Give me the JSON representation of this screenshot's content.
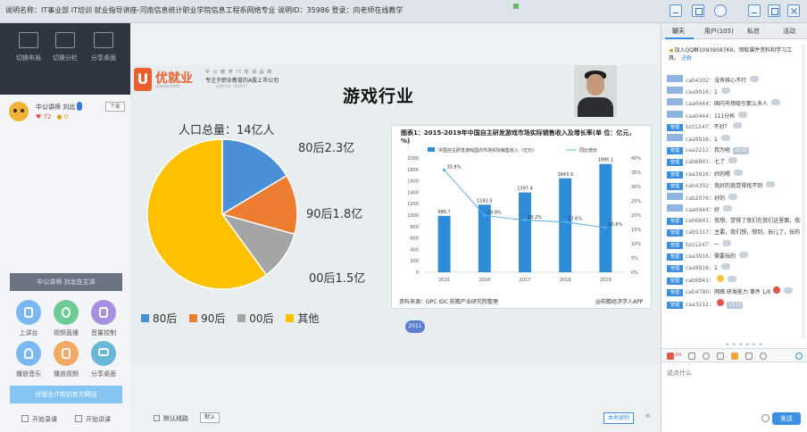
{
  "titlebar": {
    "text": "说明名称：IT事业部 IT培训 就业指导讲座-河南信息统计职业学院信息工程系网络专业 说明ID：35986 登录：向老师在线教学"
  },
  "left": {
    "tools": [
      {
        "label": "切换布局",
        "icon": "layout-icon"
      },
      {
        "label": "切换分栏",
        "icon": "column-icon"
      },
      {
        "label": "分享桌面",
        "icon": "share-desktop-icon"
      }
    ],
    "presenter": {
      "name": "中公讲师 刘北",
      "likes": "72",
      "coins": "0",
      "down_label": "下麦"
    },
    "topic": "中公讲师 刘北在主讲",
    "buttons": [
      {
        "label": "上讲台",
        "color": "#7bb7f0"
      },
      {
        "label": "视频直播",
        "color": "#6ecb93"
      },
      {
        "label": "音量控制",
        "color": "#a890e0"
      },
      {
        "label": "播放音乐",
        "color": "#7bb7f0"
      },
      {
        "label": "播放视频",
        "color": "#f3a866"
      },
      {
        "label": "分享桌面",
        "color": "#6ab8d8"
      }
    ],
    "link": "优就业IT培训官方网站",
    "bottom": [
      {
        "label": "开始录课"
      },
      {
        "label": "开始讲课"
      }
    ]
  },
  "slide": {
    "logo_letter": "U",
    "logo_text": "优就业",
    "logo_sub": "ujiuye.com",
    "tag1": "中 公 教 育 IT 培 训 品 牌",
    "tag2": "专注于职业教育的A股上市公司",
    "tag3": "股票代码：002607",
    "title": "游戏行业",
    "population": "人口总量：14亿人",
    "pie_labels": [
      "80后2.3亿",
      "90后1.8亿",
      "00后1.5亿"
    ],
    "legend": [
      {
        "label": "80后",
        "color": "#4a90d9"
      },
      {
        "label": "90后",
        "color": "#ed7d31"
      },
      {
        "label": "00后",
        "color": "#a5a5a5"
      },
      {
        "label": "其他",
        "color": "#ffc000"
      }
    ],
    "page_num": "2011",
    "chart_title": "图表1：2015-2019年中国自主研发游戏市场实际销售收入及增长率(单 位：亿元，%)",
    "chart_legend_bar": "中国自主研发游戏国内市场实际销售收入（亿元）",
    "chart_legend_line": "同比增长",
    "chart_source": "资料来源：GPC IDC 前瞻产业研究院整理",
    "chart_source2": "@前瞻经济学人APP",
    "chat_placeholder": "说点什么吧……",
    "chat_send": "发送",
    "close": "✕"
  },
  "chart_data": [
    {
      "type": "pie",
      "title": "人口总量：14亿人",
      "categories": [
        "80后",
        "90后",
        "00后",
        "其他"
      ],
      "values": [
        2.3,
        1.8,
        1.5,
        8.4
      ],
      "labels": [
        "80后2.3亿",
        "90后1.8亿",
        "00后1.5亿"
      ],
      "colors": [
        "#4a90d9",
        "#ed7d31",
        "#a5a5a5",
        "#ffc000"
      ]
    },
    {
      "type": "bar",
      "title": "图表1：2015-2019年中国自主研发游戏市场实际销售收入及增长率(单 位：亿元，%)",
      "categories": [
        "2015",
        "2016",
        "2017",
        "2018",
        "2019"
      ],
      "series": [
        {
          "name": "中国自主研发游戏国内市场实际销售收入（亿元）",
          "values": [
            986.7,
            1182.5,
            1397.4,
            1643.9,
            1895.1
          ],
          "labels": [
            "986.7",
            "1182.5",
            "1397.4",
            "1643.9",
            "1895.1"
          ]
        },
        {
          "name": "同比增长",
          "values": [
            35.8,
            19.9,
            18.2,
            17.6,
            15.6
          ],
          "labels": [
            "35.8%",
            "19.9%",
            "18.2%",
            "17.6%",
            "15.6%"
          ]
        }
      ],
      "ylim": [
        0,
        2000
      ],
      "yticks": [
        "0",
        "200",
        "400",
        "600",
        "800",
        "1000",
        "1200",
        "1400",
        "1600",
        "1800",
        "2000"
      ],
      "y2lim": [
        0,
        40
      ],
      "y2ticks": [
        "0%",
        "5%",
        "10%",
        "15%",
        "20%",
        "25%",
        "30%",
        "35%",
        "40%"
      ],
      "bar_color": "#2e8bd8",
      "line_color": "#5aaee0",
      "grid": false,
      "legend": "top"
    }
  ],
  "stage_bottom": {
    "default_layout": "默认线路",
    "default_box": "默认",
    "local_record": "本地录制"
  },
  "right": {
    "tabs": [
      "聊天",
      "用户(105)",
      "私信",
      "活动"
    ],
    "notice": "加入QQ群1093958769，领取课件资料和学习工具。",
    "notice_link": "进群",
    "messages": [
      {
        "tag": "",
        "name": "cab4302：",
        "text": "没有核心不行"
      },
      {
        "tag": "",
        "name": "caa9916：",
        "text": "1"
      },
      {
        "tag": "",
        "name": "caa0444：",
        "text": "国内市场吸引那么多人"
      },
      {
        "tag": "",
        "name": "caa0444：",
        "text": "111分析"
      },
      {
        "tag": "管理",
        "name": "bzz1247：",
        "text": "不对？"
      },
      {
        "tag": "",
        "name": "caa9916：",
        "text": "1"
      },
      {
        "tag": "管理",
        "name": "caa2212：",
        "text": "我为啥",
        "badge": "20:32"
      },
      {
        "tag": "管理",
        "name": "cab6841：",
        "text": "七了"
      },
      {
        "tag": "管理",
        "name": "caa3916：",
        "text": "好的嗯"
      },
      {
        "tag": "管理",
        "name": "cab4302：",
        "text": "我好的我觉得找不到"
      },
      {
        "tag": "",
        "name": "cab2076：",
        "text": "好的"
      },
      {
        "tag": "",
        "name": "caa0444：",
        "text": "好"
      },
      {
        "tag": "管理",
        "name": "cab6841：",
        "text": "我想，觉得了我们在我们这里面，我要"
      },
      {
        "tag": "管理",
        "name": "cab5317：",
        "text": "主要，我们想，想到，玩儿了，玩的"
      },
      {
        "tag": "管理",
        "name": "bzz1247：",
        "text": "一"
      },
      {
        "tag": "管理",
        "name": "caa3916：",
        "text": "需要玩的"
      },
      {
        "tag": "管理",
        "name": "caa9916：",
        "text": "1"
      },
      {
        "tag": "管理",
        "name": "cab6841：",
        "text": "",
        "emoji": "yellow"
      },
      {
        "tag": "管理",
        "name": "cab4780：",
        "text": "网络 研发能力 事件 1/0",
        "emoji": "red"
      },
      {
        "tag": "管理",
        "name": "caa3212：",
        "text": "",
        "emoji": "red",
        "badge": "13:12"
      }
    ],
    "toolbar_count": "69",
    "input_placeholder": "说点什么",
    "send": "发送"
  }
}
